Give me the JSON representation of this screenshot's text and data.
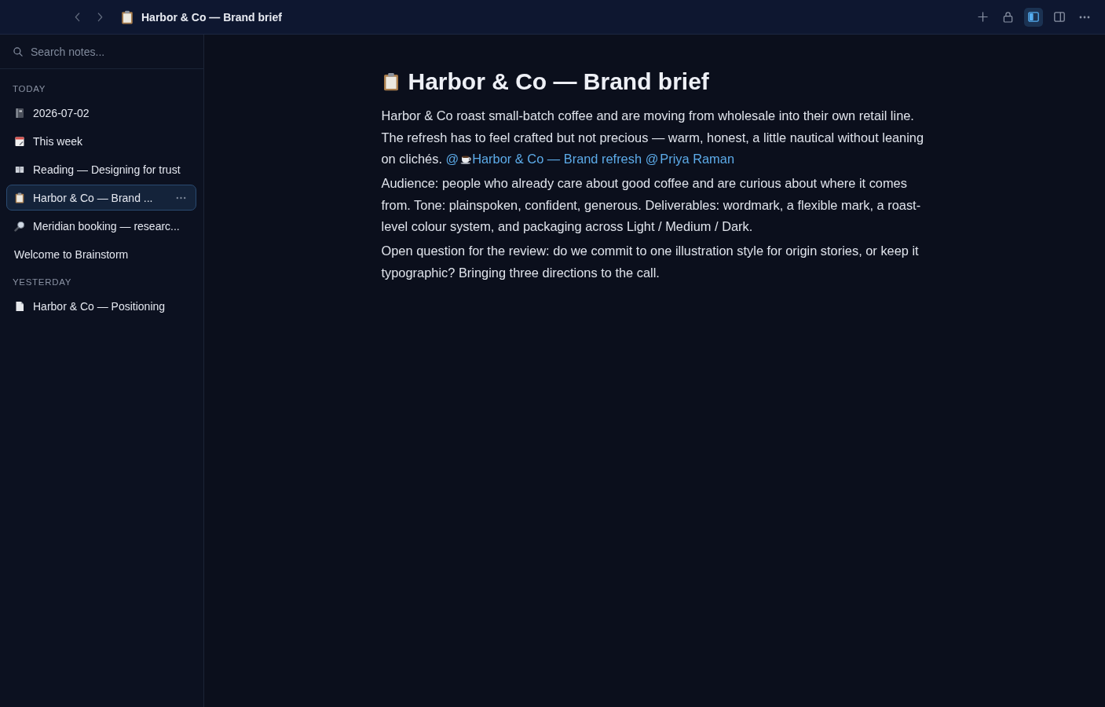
{
  "top_bar": {
    "nav": [
      {
        "kind": "back"
      },
      {
        "kind": "forward"
      }
    ],
    "title": "Harbor & Co — Brand brief",
    "toolbar": [
      {
        "kind": "add",
        "on": false
      },
      {
        "kind": "lock",
        "on": false
      },
      {
        "kind": "left-panel",
        "on": true
      },
      {
        "kind": "right-panel",
        "on": false
      },
      {
        "kind": "more",
        "on": false
      }
    ]
  },
  "sidebar": {
    "search": {
      "placeholder": "Search notes..."
    },
    "sections": [
      {
        "heading": "TODAY",
        "items": [
          {
            "kind": "notebook",
            "title": "2026-07-02",
            "selected": false
          },
          {
            "kind": "calendar",
            "title": "This week",
            "selected": false
          },
          {
            "kind": "book",
            "title": "Reading — Designing for trust",
            "selected": false
          },
          {
            "kind": "clipboard",
            "title": "Harbor & Co — Brand ...",
            "selected": true
          },
          {
            "kind": "magnifier",
            "title": "Meridian booking — researc...",
            "selected": false
          },
          {
            "kind": "plain",
            "title": "Welcome to Brainstorm",
            "selected": false
          }
        ]
      },
      {
        "heading": "YESTERDAY",
        "items": [
          {
            "kind": "page",
            "title": "Harbor & Co — Positioning",
            "selected": false
          }
        ]
      }
    ]
  },
  "note": {
    "title": "Harbor & Co — Brand brief",
    "paragraphs": [
      {
        "text": "Harbor & Co roast small-batch coffee and are moving from wholesale into their own retail line. The refresh has to feel crafted but not precious — warm, honest, a little nautical without leaning on clichés.",
        "mentions": [
          {
            "kind": "page",
            "prefix": "@",
            "label": "Harbor & Co — Brand refresh"
          },
          {
            "kind": "person",
            "prefix": "@",
            "label": "Priya Raman"
          }
        ]
      },
      {
        "text": "Audience: people who already care about good coffee and are curious about where it comes from. Tone: plainspoken, confident, generous. Deliverables: wordmark, a flexible mark, a roast-level colour system, and packaging across Light / Medium / Dark."
      },
      {
        "text": "Open question for the review: do we commit to one illustration style for origin stories, or keep it typographic? Bringing three directions to the call."
      }
    ]
  }
}
